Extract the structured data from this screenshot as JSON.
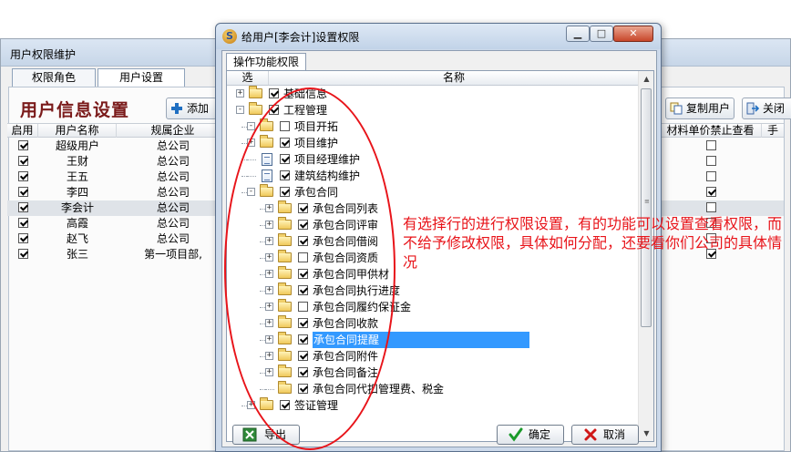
{
  "bg_window": {
    "title": "用户权限维护",
    "tabs": [
      "权限角色",
      "用户设置"
    ],
    "heading": "用户信息设置",
    "add_button": "添加",
    "copy_user_button": "复制用户",
    "close_button": "关闭",
    "columns": [
      "启用",
      "用户名称",
      "规属企业",
      "材料单价禁止查看",
      "手"
    ],
    "rows": [
      {
        "enabled": true,
        "name": "超级用户",
        "company": "总公司",
        "price_hidden": false
      },
      {
        "enabled": true,
        "name": "王财",
        "company": "总公司",
        "price_hidden": false
      },
      {
        "enabled": true,
        "name": "王五",
        "company": "总公司",
        "price_hidden": false
      },
      {
        "enabled": true,
        "name": "李四",
        "company": "总公司",
        "price_hidden": true
      },
      {
        "enabled": true,
        "name": "李会计",
        "company": "总公司",
        "price_hidden": false
      },
      {
        "enabled": true,
        "name": "高霞",
        "company": "总公司",
        "price_hidden": false
      },
      {
        "enabled": true,
        "name": "赵飞",
        "company": "总公司",
        "price_hidden": false
      },
      {
        "enabled": true,
        "name": "张三",
        "company": "第一项目部,",
        "price_hidden": true
      }
    ]
  },
  "dialog": {
    "title": "给用户[李会计]设置权限",
    "tab": "操作功能权限",
    "col_select": "选",
    "col_name": "名称",
    "tree": [
      {
        "label": "基础信息",
        "level": 0,
        "checked": true,
        "expander": "+",
        "icon": "folder"
      },
      {
        "label": "工程管理",
        "level": 0,
        "checked": true,
        "expander": "-",
        "icon": "folder-open"
      },
      {
        "label": "项目开拓",
        "level": 1,
        "checked": false,
        "expander": "-",
        "icon": "folder-open"
      },
      {
        "label": "项目维护",
        "level": 1,
        "checked": true,
        "expander": "+",
        "icon": "folder"
      },
      {
        "label": "项目经理维护",
        "level": 1,
        "checked": true,
        "expander": "",
        "icon": "doc"
      },
      {
        "label": "建筑结构维护",
        "level": 1,
        "checked": true,
        "expander": "",
        "icon": "doc"
      },
      {
        "label": "承包合同",
        "level": 1,
        "checked": true,
        "expander": "-",
        "icon": "folder-open"
      },
      {
        "label": "承包合同列表",
        "level": 2,
        "checked": true,
        "expander": "+",
        "icon": "folder"
      },
      {
        "label": "承包合同评审",
        "level": 2,
        "checked": true,
        "expander": "+",
        "icon": "folder"
      },
      {
        "label": "承包合同借阅",
        "level": 2,
        "checked": true,
        "expander": "+",
        "icon": "folder"
      },
      {
        "label": "承包合同资质",
        "level": 2,
        "checked": false,
        "expander": "+",
        "icon": "folder"
      },
      {
        "label": "承包合同甲供材",
        "level": 2,
        "checked": true,
        "expander": "+",
        "icon": "folder"
      },
      {
        "label": "承包合同执行进度",
        "level": 2,
        "checked": true,
        "expander": "+",
        "icon": "folder"
      },
      {
        "label": "承包合同履约保证金",
        "level": 2,
        "checked": false,
        "expander": "+",
        "icon": "folder"
      },
      {
        "label": "承包合同收款",
        "level": 2,
        "checked": true,
        "expander": "+",
        "icon": "folder"
      },
      {
        "label": "承包合同提醒",
        "level": 2,
        "checked": true,
        "expander": "+",
        "icon": "folder",
        "selected": true
      },
      {
        "label": "承包合同附件",
        "level": 2,
        "checked": true,
        "expander": "+",
        "icon": "folder"
      },
      {
        "label": "承包合同备注",
        "level": 2,
        "checked": true,
        "expander": "+",
        "icon": "folder"
      },
      {
        "label": "承包合同代扣管理费、税金",
        "level": 2,
        "checked": true,
        "expander": "",
        "icon": "folder"
      },
      {
        "label": "签证管理",
        "level": 1,
        "checked": true,
        "expander": "+",
        "icon": "folder"
      }
    ],
    "export_button": "导出",
    "ok_button": "确定",
    "cancel_button": "取消"
  },
  "annotation": {
    "text": "有选择行的进行权限设置，有的功能可以设置查看权限，而不给予修改权限，具体如何分配，还要看你们公司的具体情况",
    "color": "#e8141a"
  },
  "colors": {
    "selection": "#3399ff",
    "heading": "#7a1a1a",
    "annotation": "#e8141a"
  }
}
